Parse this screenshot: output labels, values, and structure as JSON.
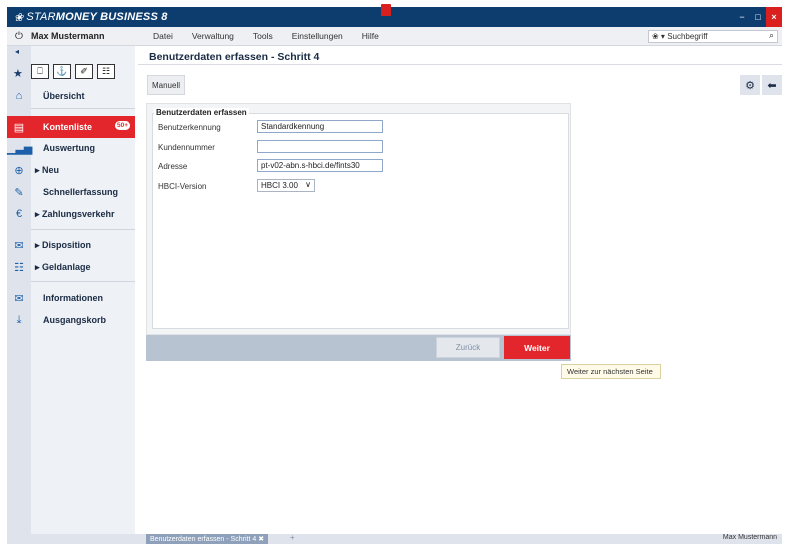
{
  "app": {
    "title_prefix": "STAR",
    "title_bold": "MONEY BUSINESS 8",
    "logo_glyph": "❀"
  },
  "window": {
    "minimize": "−",
    "maximize": "□",
    "close": "×"
  },
  "menubar": {
    "power_icon": "⏻",
    "user": "Max Mustermann",
    "menus": [
      "Datei",
      "Verwaltung",
      "Tools",
      "Einstellungen",
      "Hilfe"
    ],
    "search_placeholder": "Suchbegriff",
    "search_prefix": "❀ ▾",
    "search_icon": "⌕"
  },
  "sidebar": {
    "collapse_icon": "◂",
    "tools": [
      "⎕",
      "⚓",
      "✐",
      "☷"
    ],
    "items": [
      {
        "label": "Übersicht",
        "icon": "⌂"
      },
      {
        "label": "Kontenliste",
        "icon": "▤",
        "badge": "50+"
      },
      {
        "label": "Auswertung",
        "icon": "▁▃▅"
      },
      {
        "label": "▸ Neu",
        "icon": "⊕"
      },
      {
        "label": "Schnellerfassung",
        "icon": "✎"
      },
      {
        "label": "▸ Zahlungsverkehr",
        "icon": "€"
      },
      {
        "label": "▸ Disposition",
        "icon": "✉"
      },
      {
        "label": "▸ Geldanlage",
        "icon": "☷"
      },
      {
        "label": "Informationen",
        "icon": "✉"
      },
      {
        "label": "Ausgangskorb",
        "icon": "⤓"
      }
    ],
    "star_icon": "★"
  },
  "main": {
    "title": "Benutzerdaten erfassen - Schritt 4",
    "manuell_label": "Manuell",
    "right_btn_icons": [
      "⚙",
      "⬅"
    ],
    "legend": "Benutzerdaten erfassen",
    "fields": [
      {
        "label": "Benutzerkennung",
        "value": "Standardkennung"
      },
      {
        "label": "Kundennummer",
        "value": ""
      },
      {
        "label": "Adresse",
        "value": "pt-v02-abn.s-hbci.de/fints30"
      },
      {
        "label": "HBCI-Version",
        "value": "HBCI 3.00"
      }
    ],
    "select_chevron": "∨",
    "back_label": "Zurück",
    "next_label": "Weiter",
    "tooltip": "Weiter zur nächsten Seite"
  },
  "statusbar": {
    "tab_label": "Benutzerdaten erfassen - Schritt 4",
    "tab_close": "✖",
    "plus": "+",
    "user": "Max Mustermann"
  }
}
